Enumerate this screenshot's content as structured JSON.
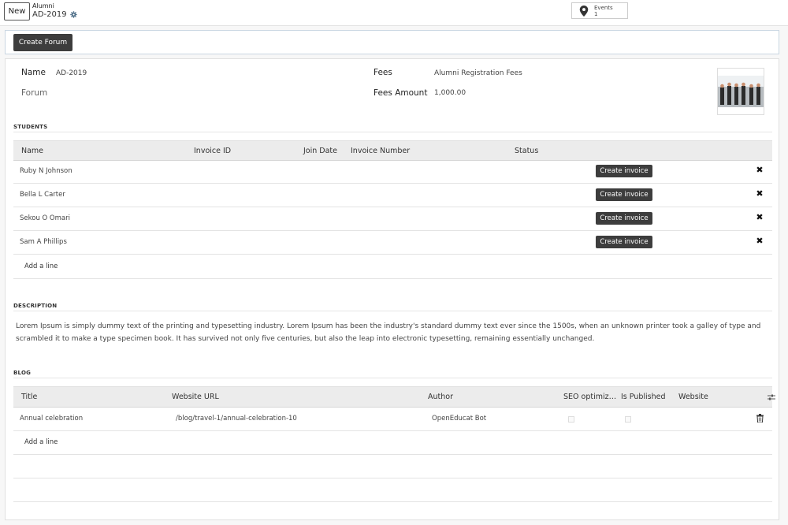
{
  "topbar": {
    "new_label": "New",
    "breadcrumb_parent": "Alumni",
    "breadcrumb_current": "AD-2019",
    "events_label": "Events",
    "events_count": "1"
  },
  "statusbar": {
    "create_forum_label": "Create Forum"
  },
  "form": {
    "name_label": "Name",
    "name_value": "AD-2019",
    "forum_label": "Forum",
    "fees_label": "Fees",
    "fees_value": "Alumni Registration Fees",
    "fees_amount_label": "Fees Amount",
    "fees_amount_value": "1,000.00"
  },
  "students": {
    "section_title": "STUDENTS",
    "columns": [
      "Name",
      "Invoice ID",
      "Join Date",
      "Invoice Number",
      "Status"
    ],
    "rows": [
      {
        "name": "Ruby N Johnson",
        "action": "Create invoice"
      },
      {
        "name": "Bella L Carter",
        "action": "Create invoice"
      },
      {
        "name": "Sekou O Omari",
        "action": "Create invoice"
      },
      {
        "name": "Sam A Phillips",
        "action": "Create invoice"
      }
    ],
    "add_line": "Add a line"
  },
  "description": {
    "section_title": "DESCRIPTION",
    "text": "Lorem Ipsum is simply dummy text of the printing and typesetting industry. Lorem Ipsum has been the industry's standard dummy text ever since the 1500s, when an unknown printer took a galley of type and scrambled it to make a type specimen book. It has survived not only five centuries, but also the leap into electronic typesetting, remaining essentially unchanged."
  },
  "blog": {
    "section_title": "BLOG",
    "columns": [
      "Title",
      "Website URL",
      "Author",
      "SEO optimiz…",
      "Is Published",
      "Website"
    ],
    "rows": [
      {
        "title": "Annual celebration",
        "url": "/blog/travel-1/annual-celebration-10",
        "author": "OpenEducat Bot",
        "seo": false,
        "published": false
      }
    ],
    "add_line": "Add a line"
  }
}
